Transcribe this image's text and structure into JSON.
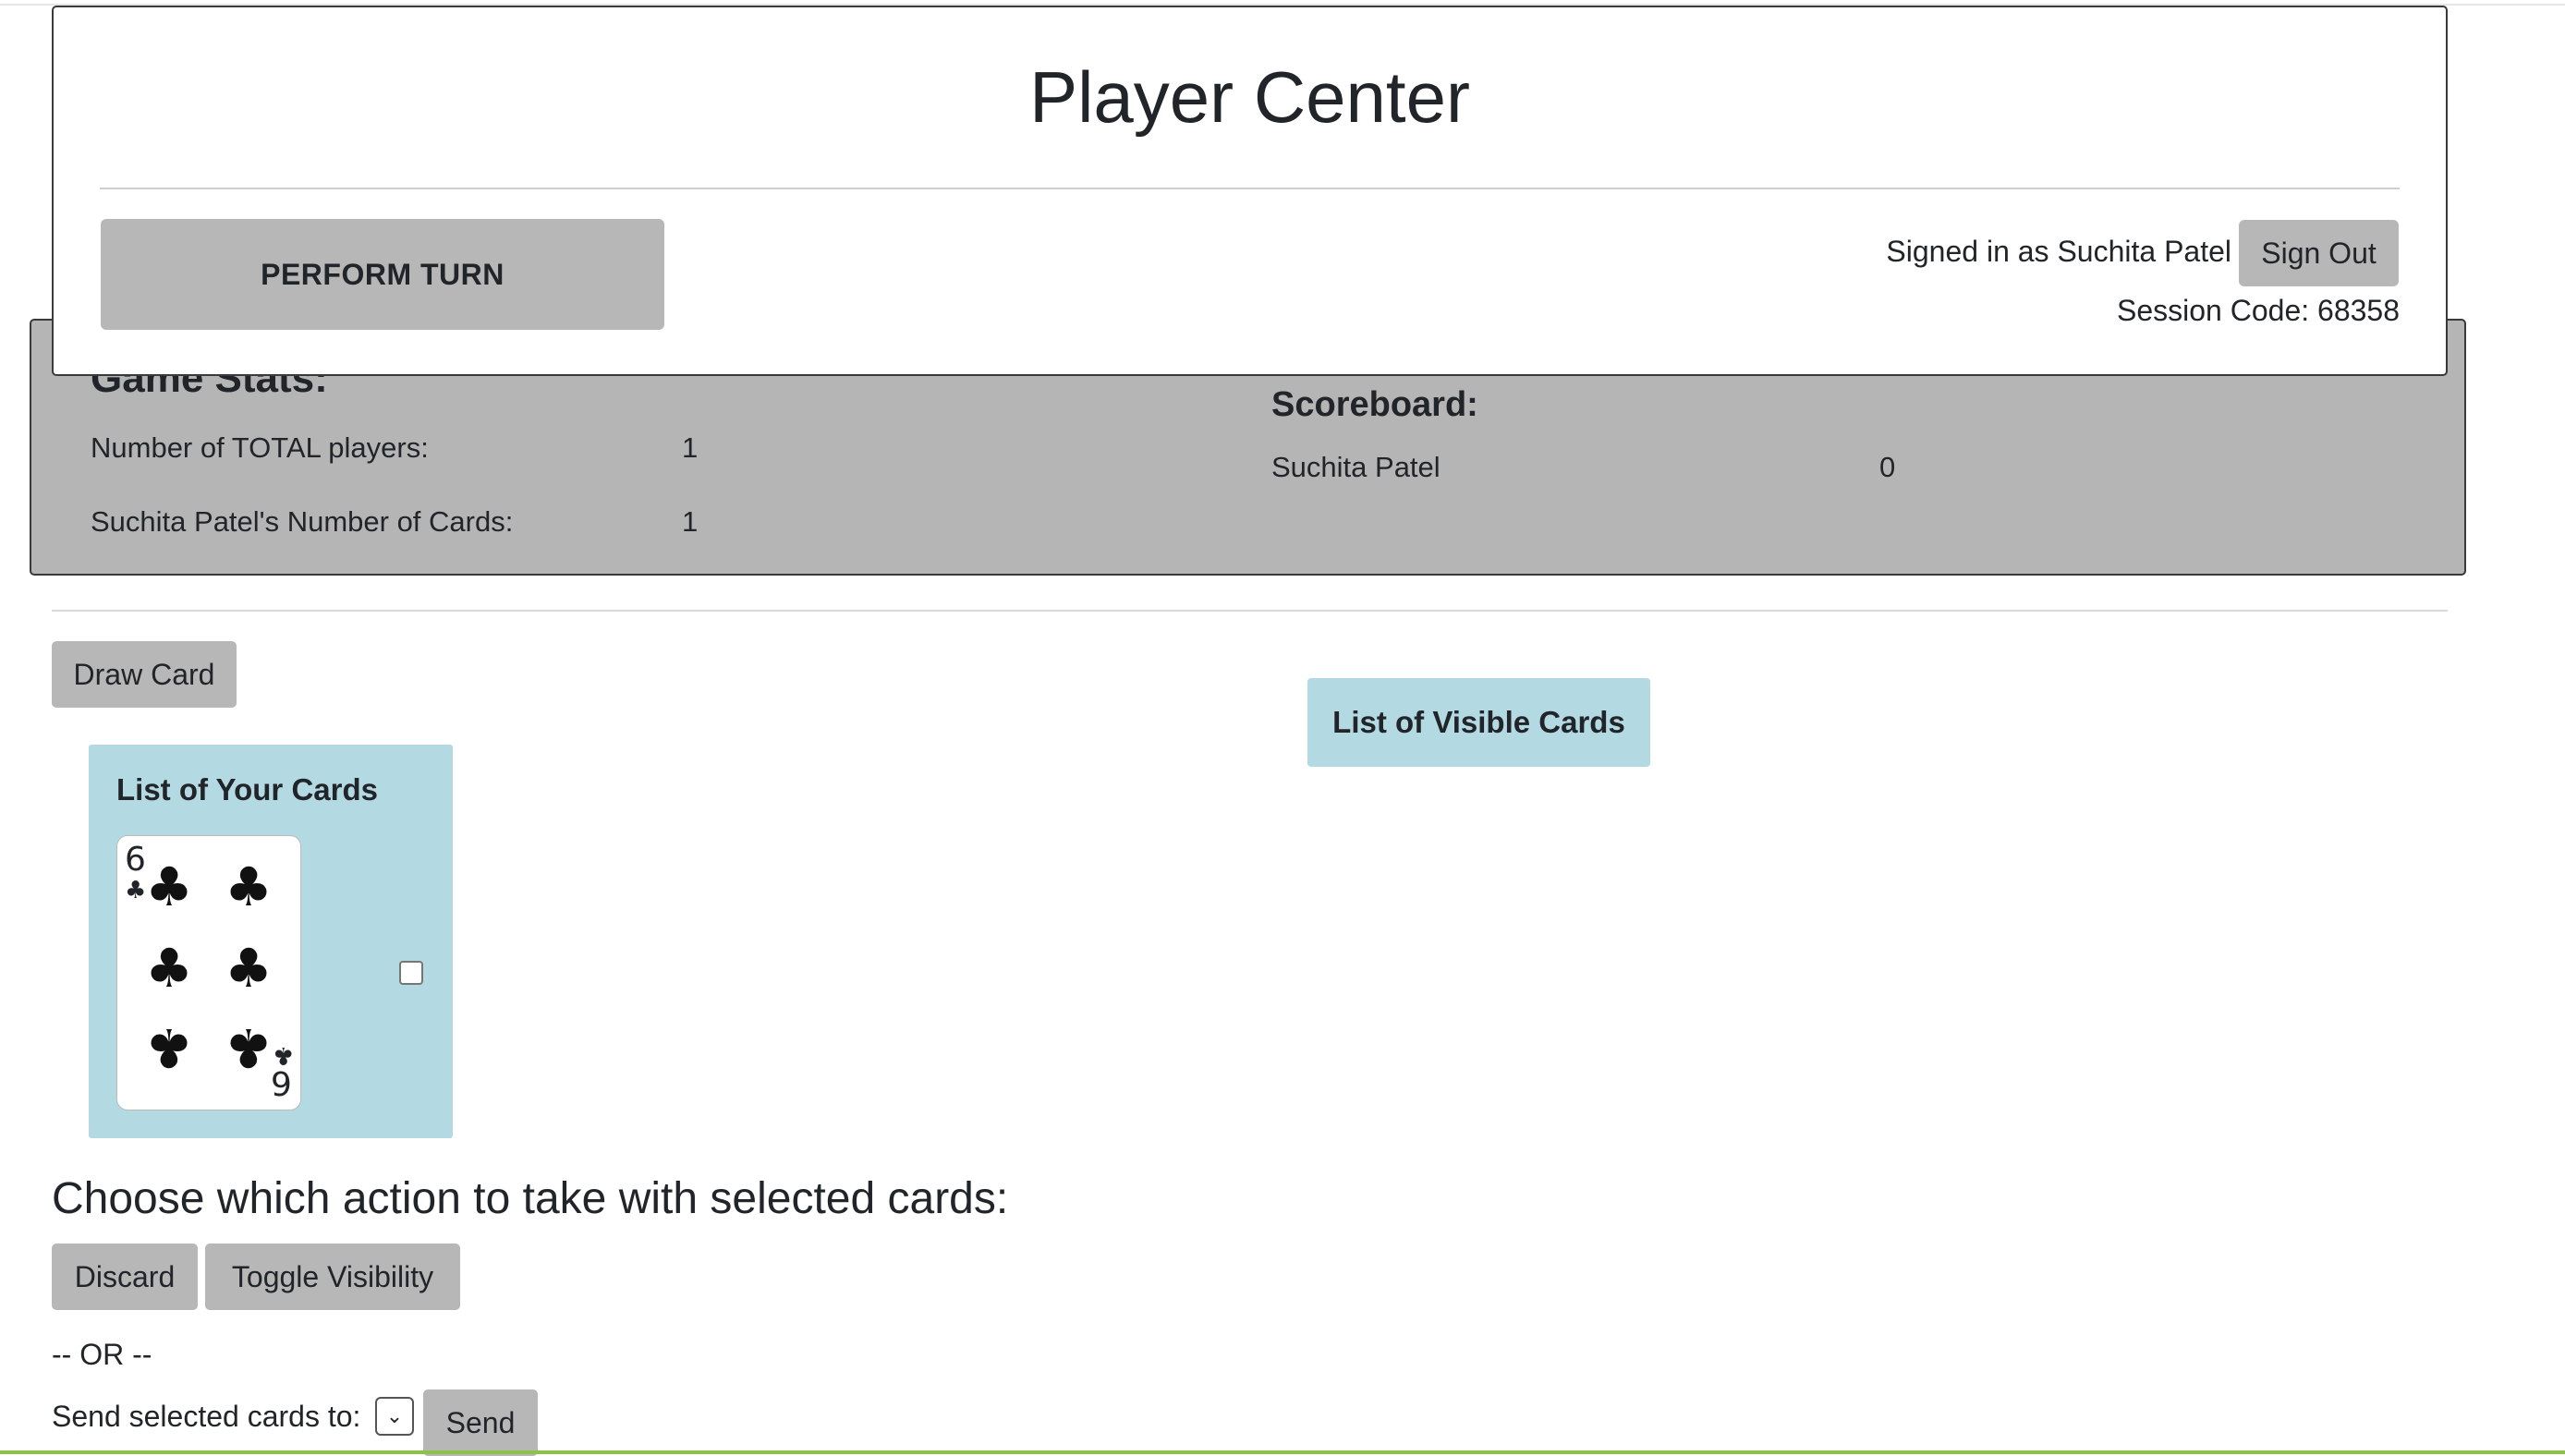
{
  "header": {
    "title": "Player Center",
    "perform_turn_label": "PERFORM TURN",
    "signed_in_text": "Signed in as Suchita Patel",
    "sign_out_label": "Sign Out",
    "session_text": "Session Code: 68358"
  },
  "stats": {
    "title": "Game Stats:",
    "rows": [
      {
        "label": "Number of TOTAL players:",
        "value": "1"
      },
      {
        "label": "Suchita Patel's Number of Cards:",
        "value": "1"
      }
    ]
  },
  "scoreboard": {
    "title": "Scoreboard:",
    "rows": [
      {
        "name": "Suchita Patel",
        "score": "0"
      }
    ]
  },
  "draw_card_label": "Draw Card",
  "your_cards": {
    "title": "List of Your Cards",
    "cards": [
      {
        "rank": "6",
        "suit": "clubs",
        "suit_symbol": "♣",
        "icon": "six-of-clubs-card",
        "selected": false
      }
    ]
  },
  "visible_cards_label": "List of Visible Cards",
  "actions": {
    "title": "Choose which action to take with selected cards:",
    "discard_label": "Discard",
    "toggle_label": "Toggle Visibility",
    "or_text": "-- OR --",
    "send_to_label": "Send selected cards to:",
    "send_select_value": "",
    "send_label": "Send"
  }
}
